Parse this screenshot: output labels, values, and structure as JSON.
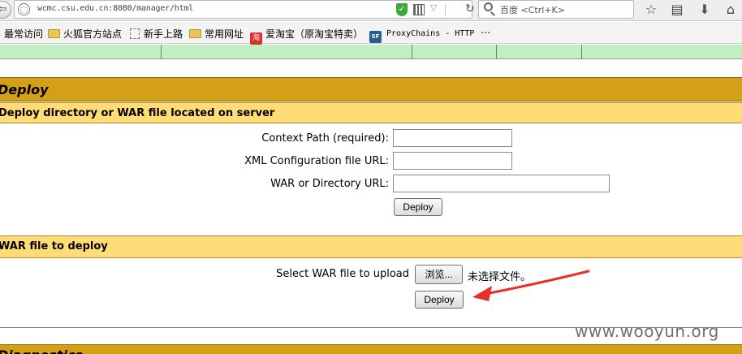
{
  "browser": {
    "url": "wcmc.csu.edu.cn:8080/manager/html",
    "search_placeholder": "百度 <Ctrl+K>",
    "bookmarks": [
      {
        "label": "最常访问",
        "icon": "none"
      },
      {
        "label": "火狐官方站点",
        "icon": "folder-icon"
      },
      {
        "label": "新手上路",
        "icon": "page-icon"
      },
      {
        "label": "常用网址",
        "icon": "folder-icon"
      },
      {
        "label": "爱淘宝（原淘宝特卖）",
        "icon": "taobao-icon"
      },
      {
        "label": "ProxyChains - HTTP",
        "icon": "sf-icon"
      }
    ],
    "bookmarks_overflow": "⋯",
    "sf_icon_text": "SF"
  },
  "page": {
    "deploy_title": "Deploy",
    "server_section_title": "Deploy directory or WAR file located on server",
    "form": {
      "context_path_label": "Context Path (required):",
      "xml_config_label": "XML Configuration file URL:",
      "war_dir_label": "WAR or Directory URL:",
      "context_path_value": "",
      "xml_config_value": "",
      "war_dir_value": "",
      "deploy_button": "Deploy"
    },
    "upload_section_title": "WAR file to deploy",
    "upload": {
      "select_label": "Select WAR file to upload",
      "browse_button": "浏览...",
      "no_file_text": "未选择文件。",
      "deploy_button": "Deploy"
    },
    "next_section_title": "Diagnostics"
  },
  "annotation": {
    "arrow_color": "#e8302a",
    "watermark": "www.wooyun.org"
  },
  "colors": {
    "section_header": "#d4a017",
    "subsection": "#ffdc75",
    "status_row": "#c3f0c3"
  }
}
